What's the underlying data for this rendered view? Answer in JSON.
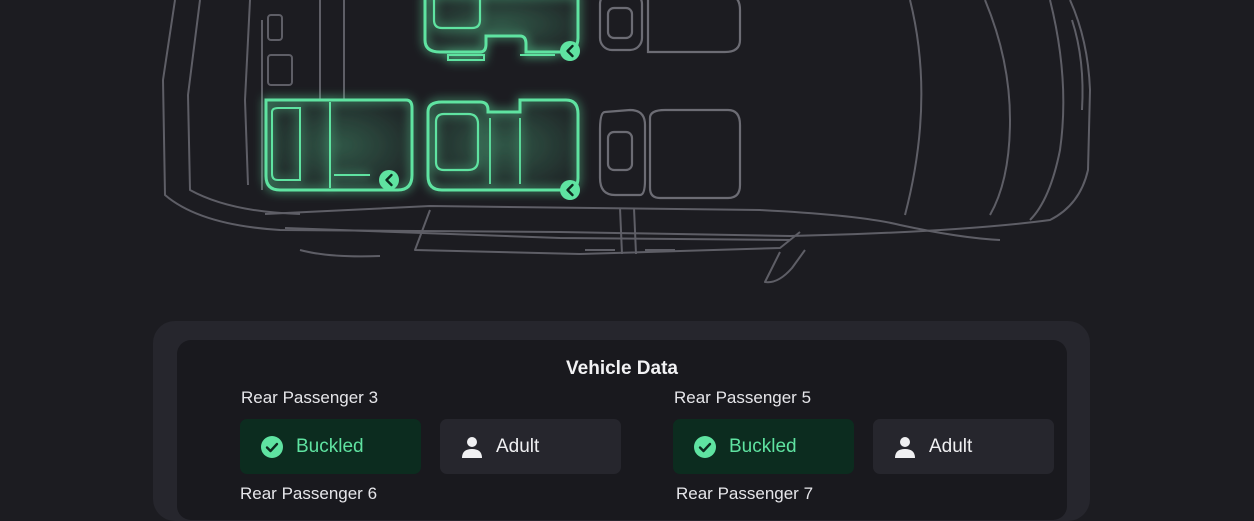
{
  "vehicle_data": {
    "title": "Vehicle Data",
    "passengers": [
      {
        "label": "Rear Passenger 3",
        "status": "Buckled",
        "occupant": "Adult"
      },
      {
        "label": "Rear Passenger 5",
        "status": "Buckled",
        "occupant": "Adult"
      },
      {
        "label": "Rear Passenger 6"
      },
      {
        "label": "Rear Passenger 7"
      }
    ]
  },
  "colors": {
    "background": "#1c1c21",
    "seat_active": "#5fe3a1",
    "seat_inactive": "#6c6c74",
    "car_outline": "#5e5e66",
    "buckled_bg": "#0c2c1f",
    "buckled_text": "#5fe3a1",
    "adult_bg": "#26262d"
  },
  "icons": {
    "buckled": "check-circle-icon",
    "adult": "person-icon",
    "seat_marker": "chevron-left-icon"
  }
}
